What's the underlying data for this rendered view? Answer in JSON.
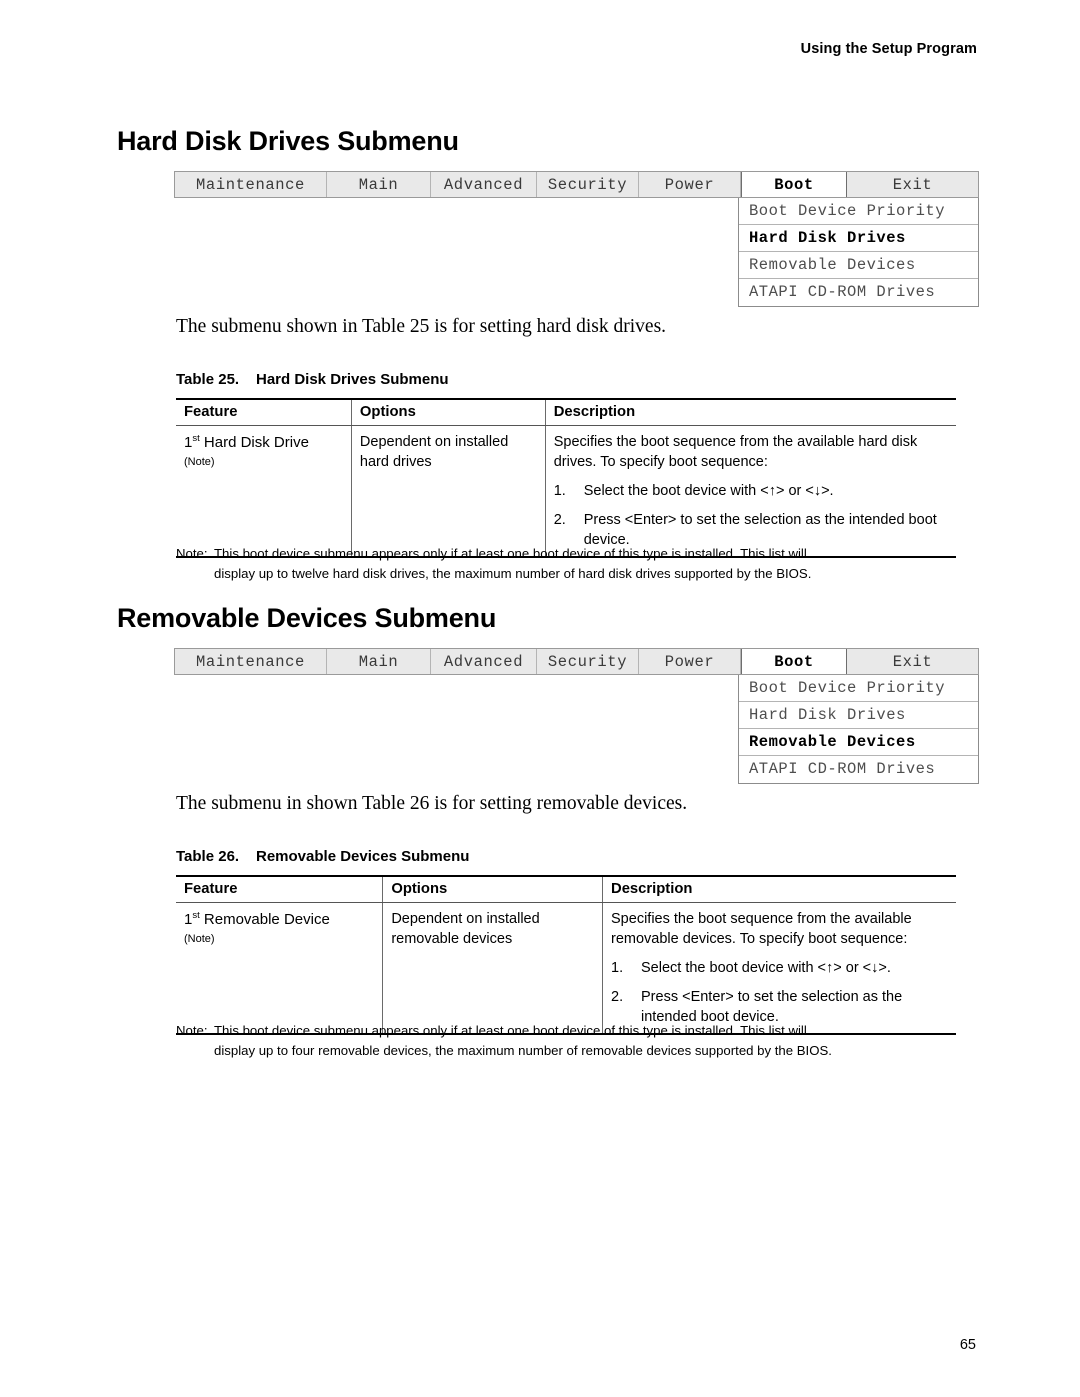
{
  "header": {
    "running_title": "Using the Setup Program"
  },
  "page_footer": {
    "page_number": "65"
  },
  "sections": [
    {
      "heading": "Hard Disk Drives Submenu",
      "intro": "The submenu shown in Table 25 is for setting hard disk drives.",
      "caption_number": "Table 25.",
      "caption_title": "Hard Disk Drives Submenu"
    },
    {
      "heading": "Removable Devices Submenu",
      "intro": "The submenu in shown Table 26 is for setting removable devices.",
      "caption_number": "Table 26.",
      "caption_title": "Removable Devices Submenu"
    }
  ],
  "bios_menu": {
    "tabs": [
      {
        "label": "Maintenance",
        "active": false
      },
      {
        "label": "Main",
        "active": false
      },
      {
        "label": "Advanced",
        "active": false
      },
      {
        "label": "Security",
        "active": false
      },
      {
        "label": "Power",
        "active": false
      },
      {
        "label": "Boot",
        "active": true
      },
      {
        "label": "Exit",
        "active": false
      }
    ],
    "submenu_1": [
      {
        "label": "Boot Device Priority",
        "selected": false
      },
      {
        "label": "Hard Disk Drives",
        "selected": true
      },
      {
        "label": "Removable Devices",
        "selected": false
      },
      {
        "label": "ATAPI CD-ROM Drives",
        "selected": false
      }
    ],
    "submenu_2": [
      {
        "label": "Boot Device Priority",
        "selected": false
      },
      {
        "label": "Hard Disk Drives",
        "selected": false
      },
      {
        "label": "Removable Devices",
        "selected": true
      },
      {
        "label": "ATAPI CD-ROM Drives",
        "selected": false
      }
    ]
  },
  "table_25": {
    "columns": [
      "Feature",
      "Options",
      "Description"
    ],
    "row": {
      "feature_prefix": "1",
      "feature_sup": "st",
      "feature_rest": " Hard Disk Drive",
      "feature_note": "(Note)",
      "options": "Dependent on installed hard drives",
      "description_lead": "Specifies the boot sequence from the available hard disk drives.  To specify boot sequence:",
      "steps": [
        {
          "num": "1.",
          "text": "Select the boot device with <↑> or <↓>."
        },
        {
          "num": "2.",
          "text": "Press <Enter> to set the selection as the intended boot device."
        }
      ]
    },
    "note_label": "Note:",
    "note_line1": "This boot device submenu appears only if at least one boot device of this type is installed.  This list will",
    "note_line2": "display up to twelve hard disk drives, the maximum number of hard disk drives supported by the BIOS."
  },
  "table_26": {
    "columns": [
      "Feature",
      "Options",
      "Description"
    ],
    "row": {
      "feature_prefix": "1",
      "feature_sup": "st",
      "feature_rest": " Removable Device",
      "feature_note": "(Note)",
      "options": "Dependent on installed removable devices",
      "description_lead": "Specifies the boot sequence from the available removable devices.  To specify boot sequence:",
      "steps": [
        {
          "num": "1.",
          "text": "Select the boot device with <↑> or <↓>."
        },
        {
          "num": "2.",
          "text": "Press <Enter> to set the selection as the intended boot device."
        }
      ]
    },
    "note_label": "Note:",
    "note_line1": "This boot device submenu appears only if at least one boot device of this type is installed.  This list will",
    "note_line2": "display up to four removable devices, the maximum number of removable devices supported by the BIOS."
  },
  "colors": {
    "tab_inactive_bg": "#e9e9e9",
    "tab_active_bg": "#ffffff",
    "menu_text_inactive": "#4e4e4e",
    "text": "#000000"
  }
}
